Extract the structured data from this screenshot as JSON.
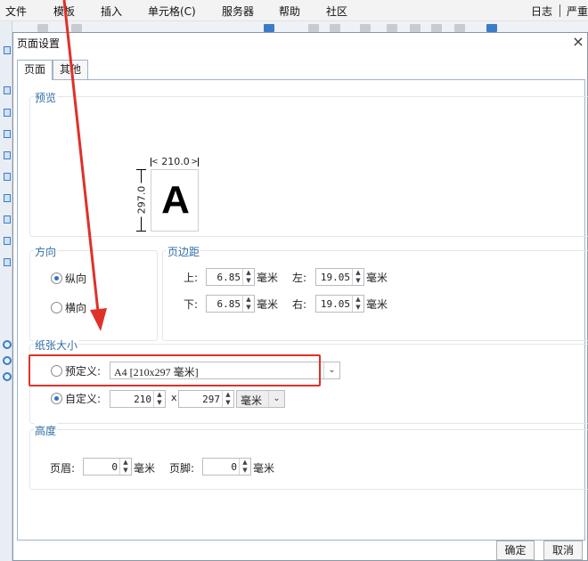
{
  "menubar": {
    "items": [
      "文件",
      "模板",
      "插入",
      "单元格(C)",
      "服务器",
      "帮助",
      "社区"
    ],
    "right_items": [
      "日志",
      "严重"
    ]
  },
  "dialog": {
    "title": "页面设置",
    "close_icon": "close-icon",
    "tabs": [
      "页面",
      "其他"
    ],
    "active_tab": "页面",
    "preview": {
      "label": "预览",
      "width_label": "210.0",
      "height_label": "297.0",
      "sample_letter": "A"
    },
    "orientation": {
      "label": "方向",
      "options": [
        "纵向",
        "横向"
      ],
      "selected": "纵向"
    },
    "margins": {
      "label": "页边距",
      "top_label": "上:",
      "top_value": "6.85",
      "left_label": "左:",
      "left_value": "19.05",
      "bottom_label": "下:",
      "bottom_value": "6.85",
      "right_label": "右:",
      "right_value": "19.05",
      "unit": "毫米"
    },
    "paper_size": {
      "label": "纸张大小",
      "predefined_label": "预定义:",
      "predefined_value": "A4 [210x297 毫米]",
      "custom_label": "自定义:",
      "custom_width": "210",
      "times_sign": "x",
      "custom_height": "297",
      "custom_unit": "毫米",
      "selected": "自定义"
    },
    "height": {
      "label": "高度",
      "header_label": "页眉:",
      "header_value": "0",
      "footer_label": "页脚:",
      "footer_value": "0",
      "unit": "毫米"
    },
    "ok_label": "确定",
    "cancel_label": "取消"
  },
  "annotation": {
    "color": "#e0302a"
  }
}
